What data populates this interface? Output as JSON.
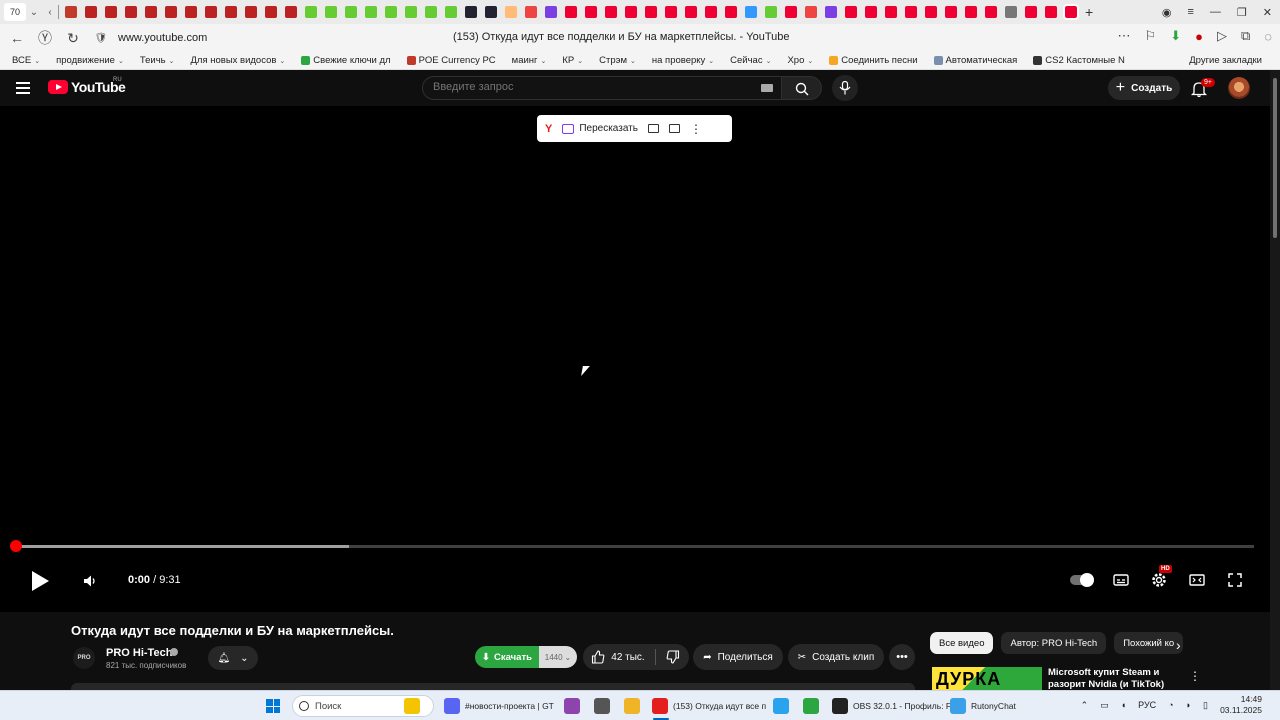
{
  "browser": {
    "tab_count": "70",
    "page_title": "(153) Откуда идут все подделки и БУ на маркетплейсы. - YouTube",
    "url": "www.youtube.com"
  },
  "tabs": {
    "favicon_colors": [
      "#c0392b",
      "#b22",
      "#b22",
      "#b22",
      "#b22",
      "#b22",
      "#b22",
      "#b22",
      "#b22",
      "#b22",
      "#b22",
      "#b22",
      "#6c3",
      "#6c3",
      "#6c3",
      "#6c3",
      "#6c3",
      "#6c3",
      "#6c3",
      "#6c3",
      "#223",
      "#223",
      "#fb7",
      "#e44",
      "#7b3fe4",
      "#e03",
      "#e03",
      "#e03",
      "#e03",
      "#e03",
      "#e03",
      "#e03",
      "#e03",
      "#e03",
      "#39f",
      "#6c3",
      "#e03",
      "#e44",
      "#7b3fe4",
      "#e03",
      "#e03",
      "#e03",
      "#e03",
      "#e03",
      "#e03",
      "#e03",
      "#e03",
      "#777",
      "#e03",
      "#e03",
      "#e03"
    ]
  },
  "bookmarks": {
    "items": [
      {
        "label": "ВСЕ",
        "color": "",
        "dropdown": true
      },
      {
        "label": "продвижение",
        "color": "",
        "dropdown": true
      },
      {
        "label": "Теичь",
        "color": "",
        "dropdown": true
      },
      {
        "label": "Для новых видосов",
        "color": "",
        "dropdown": true
      },
      {
        "label": "Свежие ключи дл",
        "color": "#2ba640",
        "dropdown": false
      },
      {
        "label": "POE Currency PC",
        "color": "#c0392b",
        "dropdown": false
      },
      {
        "label": "маинг",
        "color": "",
        "dropdown": true
      },
      {
        "label": "КР",
        "color": "",
        "dropdown": true
      },
      {
        "label": "Стрэм",
        "color": "",
        "dropdown": true
      },
      {
        "label": "на проверку",
        "color": "",
        "dropdown": true
      },
      {
        "label": "Сейчас",
        "color": "",
        "dropdown": true
      },
      {
        "label": "Хро",
        "color": "",
        "dropdown": true
      },
      {
        "label": "Соединить песни",
        "color": "#f5a623",
        "dropdown": false
      },
      {
        "label": "Автоматическая",
        "color": "#7a8fb0",
        "dropdown": false
      },
      {
        "label": "CS2 Кастомные N",
        "color": "#333",
        "dropdown": false
      }
    ],
    "other": "Другие закладки"
  },
  "youtube": {
    "logo_text": "YouTube",
    "region": "RU",
    "search_placeholder": "Введите запрос",
    "create_label": "Создать",
    "notifications_badge": "9+"
  },
  "yandex_toolbar": {
    "logo": "Y",
    "retell_label": "Пересказать"
  },
  "player": {
    "current_time": "0:00",
    "duration": "9:31",
    "played_fraction": 0,
    "buffered_fraction": 0.27,
    "hd_badge": "HD"
  },
  "video": {
    "title": "Откуда идут все подделки и БУ на маркетплейсы.",
    "channel_name": "PRO Hi-Tech",
    "channel_avatar_text": "PRO",
    "subscribers": "821 тыс. подписчиков",
    "download_label": "Скачать",
    "download_quality": "1440",
    "likes": "42 тыс.",
    "share_label": "Поделиться",
    "clip_label": "Создать клип",
    "more": "•••"
  },
  "sidebar": {
    "chips": [
      {
        "label": "Все видео",
        "active": true
      },
      {
        "label": "Автор: PRO Hi-Tech",
        "active": false
      },
      {
        "label": "Похожий ко",
        "active": false
      }
    ],
    "rec_thumb_text": "ДУРКА",
    "rec_title": "Microsoft купит Steam и разорит Nvidia (и TikTok)"
  },
  "taskbar": {
    "search_label": "Поиск",
    "apps": [
      {
        "label": "",
        "color": "#f4c400"
      },
      {
        "label": "#новости-проекта | GT",
        "color": "#5865f2"
      },
      {
        "label": "",
        "color": "#8e44ad"
      },
      {
        "label": "",
        "color": "#555"
      },
      {
        "label": "",
        "color": "#f0b429"
      },
      {
        "label": "(153) Откуда идут все п",
        "color": "#e41d1d"
      },
      {
        "label": "",
        "color": "#2aa3ef"
      },
      {
        "label": "",
        "color": "#2ba640"
      },
      {
        "label": "OBS 32.0.1 - Профиль: F",
        "color": "#222"
      },
      {
        "label": "RutonyChat",
        "color": "#3aa0e8"
      }
    ],
    "tray_lang": "РУС",
    "time": "14:49",
    "date": "03.11.2025"
  }
}
